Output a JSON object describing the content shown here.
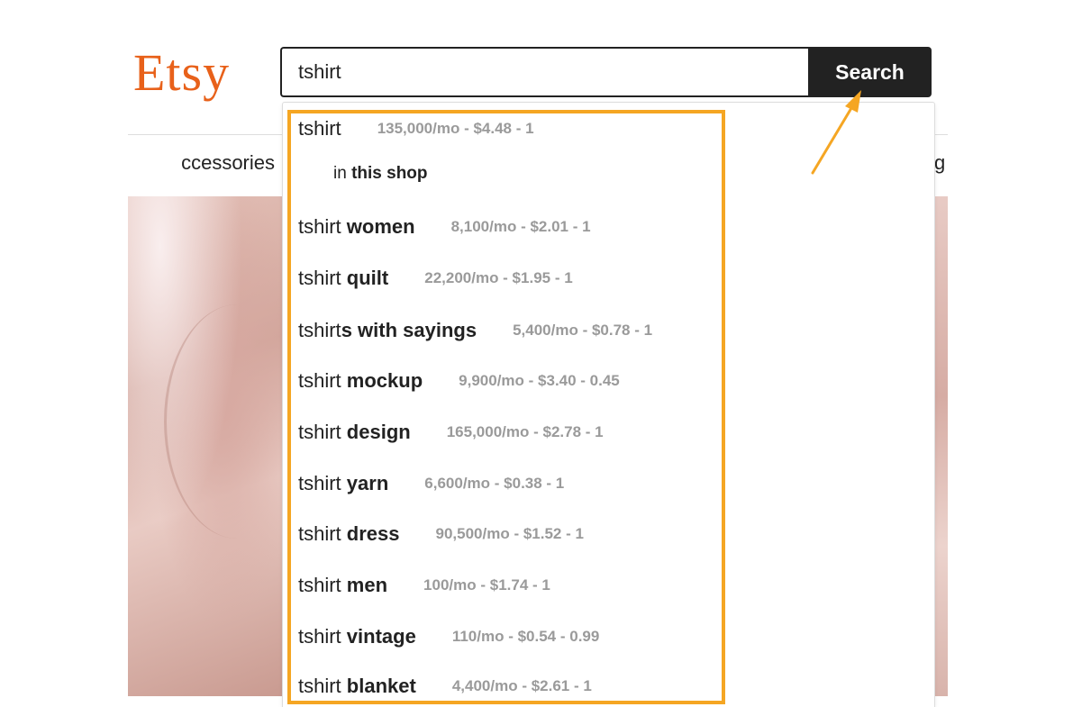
{
  "logo": {
    "text": "Etsy"
  },
  "search": {
    "value": "tshirt",
    "button_label": "Search"
  },
  "nav": {
    "left_partial": "ccessories",
    "right_partial": "g"
  },
  "suggestions": {
    "in_shop_prefix": "in ",
    "in_shop_bold": "this shop",
    "items": [
      {
        "base": "tshirt",
        "bold": "",
        "stats": "135,000/mo - $4.48 - 1"
      },
      {
        "base": "tshirt",
        "bold": " women",
        "stats": "8,100/mo - $2.01 - 1"
      },
      {
        "base": "tshirt",
        "bold": " quilt",
        "stats": "22,200/mo - $1.95 - 1"
      },
      {
        "base": "tshirt",
        "bold": "s with sayings",
        "stats": "5,400/mo - $0.78 - 1"
      },
      {
        "base": "tshirt",
        "bold": " mockup",
        "stats": "9,900/mo - $3.40 - 0.45"
      },
      {
        "base": "tshirt",
        "bold": " design",
        "stats": "165,000/mo - $2.78 - 1"
      },
      {
        "base": "tshirt",
        "bold": " yarn",
        "stats": "6,600/mo - $0.38 - 1"
      },
      {
        "base": "tshirt",
        "bold": " dress",
        "stats": "90,500/mo - $1.52 - 1"
      },
      {
        "base": "tshirt",
        "bold": " men",
        "stats": "100/mo - $1.74 - 1"
      },
      {
        "base": "tshirt",
        "bold": " vintage",
        "stats": "110/mo - $0.54 - 0.99"
      },
      {
        "base": "tshirt",
        "bold": " blanket",
        "stats": "4,400/mo - $2.61 - 1"
      }
    ]
  },
  "colors": {
    "brand": "#e8611a",
    "annotation": "#f5a623",
    "button_bg": "#222222"
  }
}
